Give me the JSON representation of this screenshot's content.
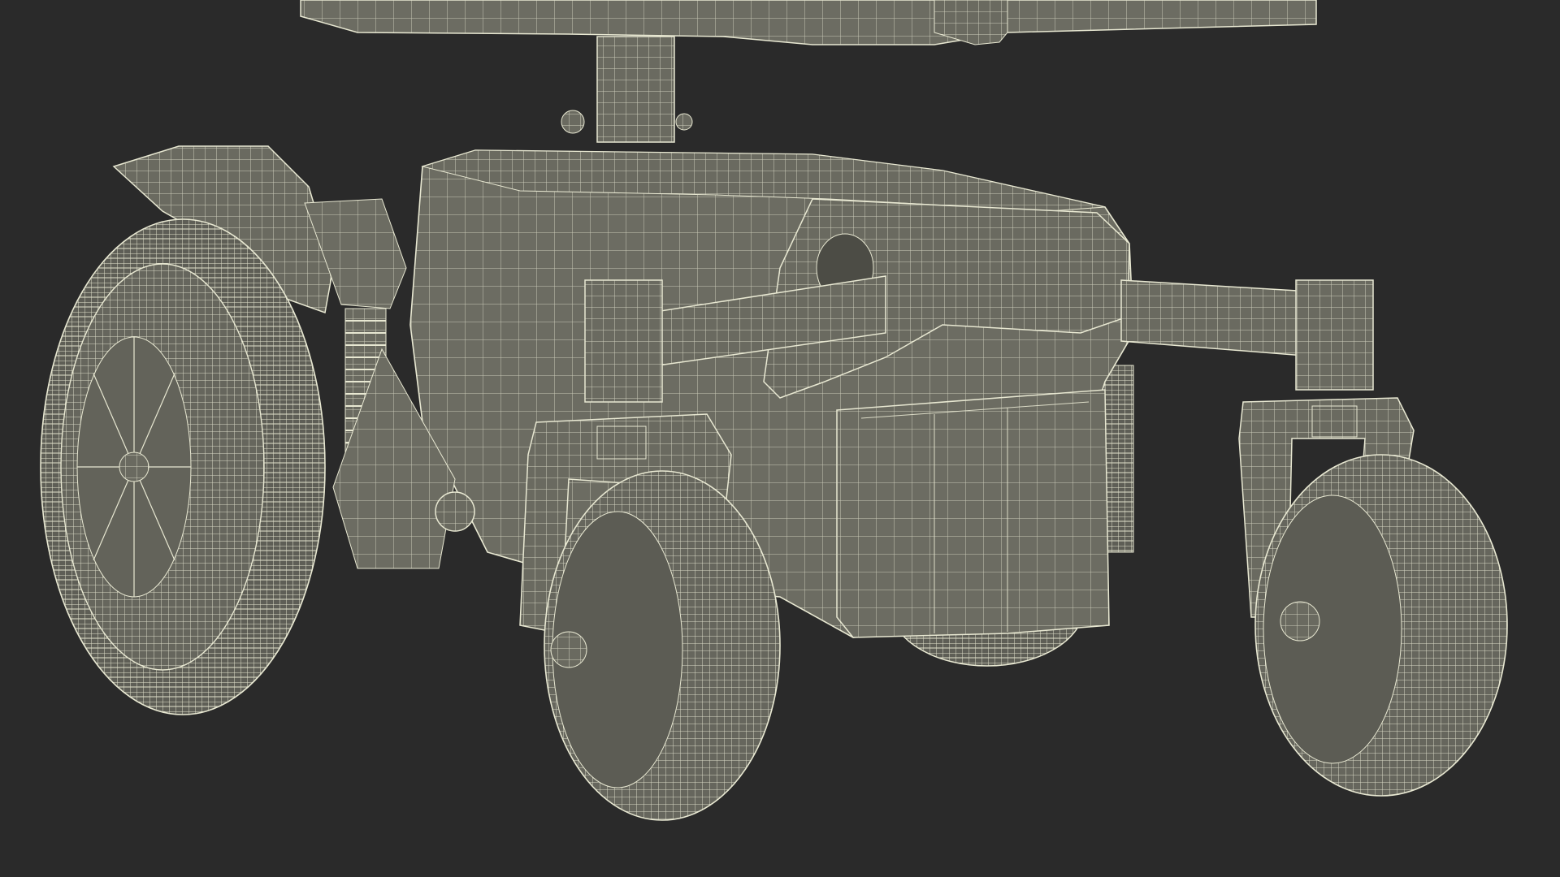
{
  "scene": {
    "background": "#2a2a2a",
    "model_fill": "#6c6c62",
    "model_fill_dark": "#55554d",
    "model_fill_light": "#7e7e73",
    "wire_color": "#e8e8d2",
    "render_style": "wireframe-over-shaded"
  },
  "parts": [
    "seat-base-plate",
    "swivel-post",
    "main-chassis",
    "front-bumper-block",
    "battery-box",
    "left-fender",
    "suspension-spring",
    "drive-wheel-left",
    "front-axle-bar",
    "caster-left",
    "caster-right",
    "rear-wheel-center"
  ]
}
